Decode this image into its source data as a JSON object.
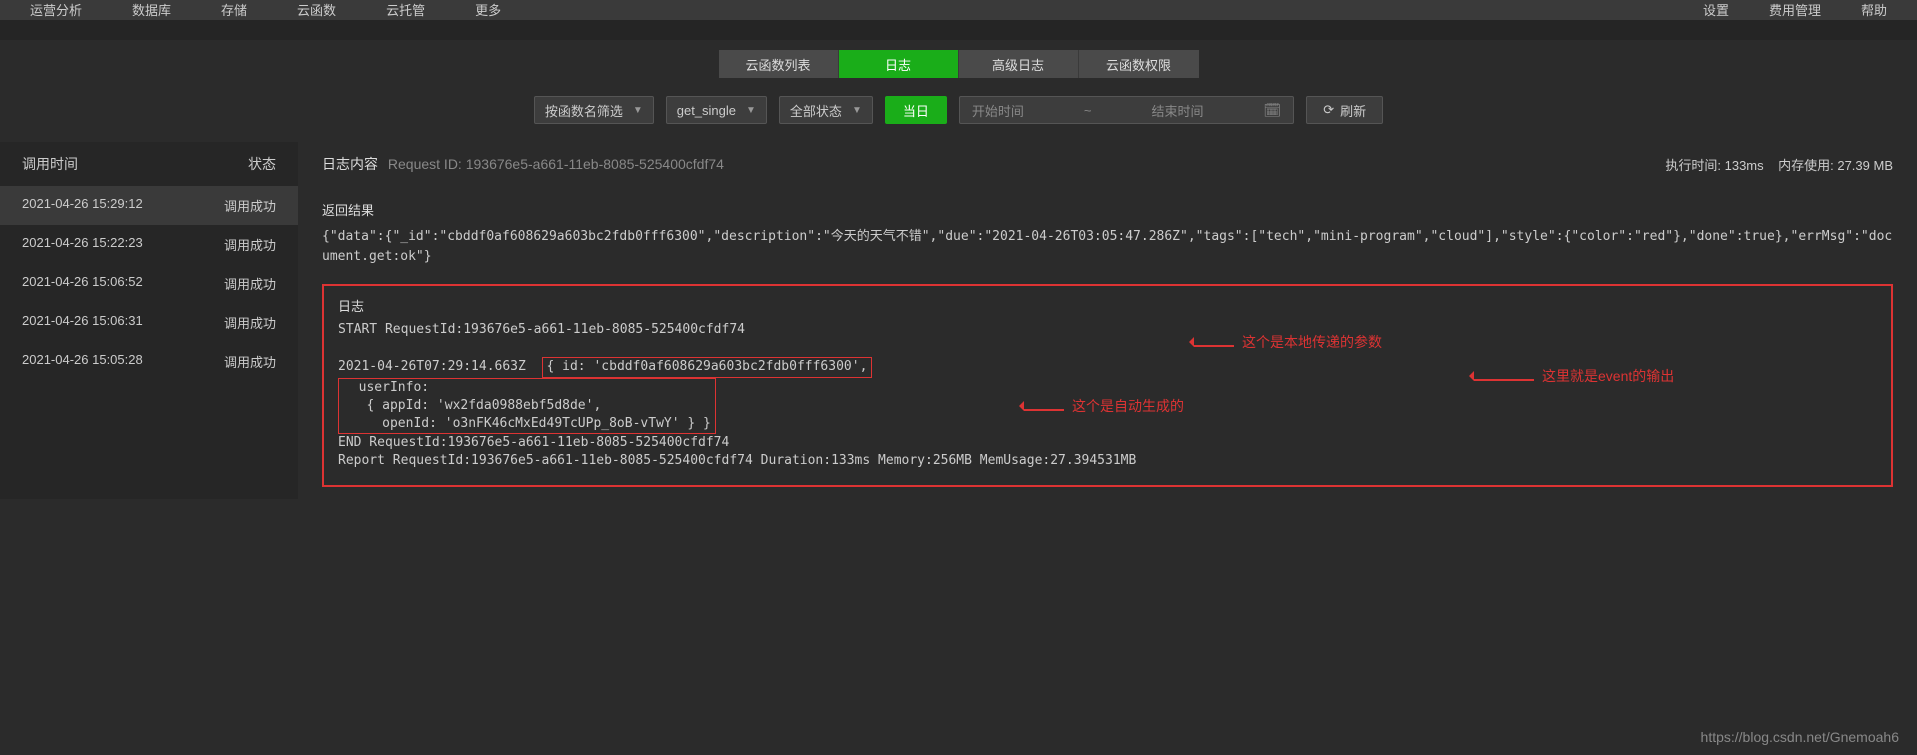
{
  "topNav": {
    "left": [
      "运营分析",
      "数据库",
      "存储",
      "云函数",
      "云托管",
      "更多"
    ],
    "right": [
      "设置",
      "费用管理",
      "帮助"
    ]
  },
  "tabs": [
    {
      "label": "云函数列表",
      "active": false
    },
    {
      "label": "日志",
      "active": true
    },
    {
      "label": "高级日志",
      "active": false
    },
    {
      "label": "云函数权限",
      "active": false
    }
  ],
  "filters": {
    "filterBy": "按函数名筛选",
    "funcName": "get_single",
    "status": "全部状态",
    "today": "当日",
    "startPlaceholder": "开始时间",
    "rangeSep": "~",
    "endPlaceholder": "结束时间",
    "refresh": "刷新"
  },
  "sidebar": {
    "header": {
      "time": "调用时间",
      "status": "状态"
    },
    "items": [
      {
        "time": "2021-04-26 15:29:12",
        "status": "调用成功",
        "selected": true
      },
      {
        "time": "2021-04-26 15:22:23",
        "status": "调用成功",
        "selected": false
      },
      {
        "time": "2021-04-26 15:06:52",
        "status": "调用成功",
        "selected": false
      },
      {
        "time": "2021-04-26 15:06:31",
        "status": "调用成功",
        "selected": false
      },
      {
        "time": "2021-04-26 15:05:28",
        "status": "调用成功",
        "selected": false
      }
    ]
  },
  "content": {
    "titleLabel": "日志内容",
    "requestIdLabel": "Request ID:",
    "requestId": "193676e5-a661-11eb-8085-525400cfdf74",
    "execTimeLabel": "执行时间:",
    "execTime": "133ms",
    "memLabel": "内存使用:",
    "mem": "27.39 MB",
    "resultLabel": "返回结果",
    "resultJson": "{\"data\":{\"_id\":\"cbddf0af608629a603bc2fdb0fff6300\",\"description\":\"今天的天气不错\",\"due\":\"2021-04-26T03:05:47.286Z\",\"tags\":[\"tech\",\"mini-program\",\"cloud\"],\"style\":{\"color\":\"red\"},\"done\":true},\"errMsg\":\"document.get:ok\"}",
    "logLabel": "日志",
    "log": {
      "start": "START RequestId:193676e5-a661-11eb-8085-525400cfdf74",
      "ts": "2021-04-26T07:29:14.663Z",
      "idLine": "{ id: 'cbddf0af608629a603bc2fdb0fff6300',",
      "userInfo1": "  userInfo:",
      "userInfo2": "   { appId: 'wx2fda0988ebf5d8de',",
      "userInfo3": "     openId: 'o3nFK46cMxEd49TcUPp_8oB-vTwY' } }",
      "end": "END RequestId:193676e5-a661-11eb-8085-525400cfdf74",
      "report": "Report RequestId:193676e5-a661-11eb-8085-525400cfdf74 Duration:133ms Memory:256MB MemUsage:27.394531MB"
    },
    "annotations": {
      "a1": "这个是本地传递的参数",
      "a2": "这个是自动生成的",
      "a3": "这里就是event的输出"
    }
  },
  "watermark": "https://blog.csdn.net/Gnemoah6"
}
